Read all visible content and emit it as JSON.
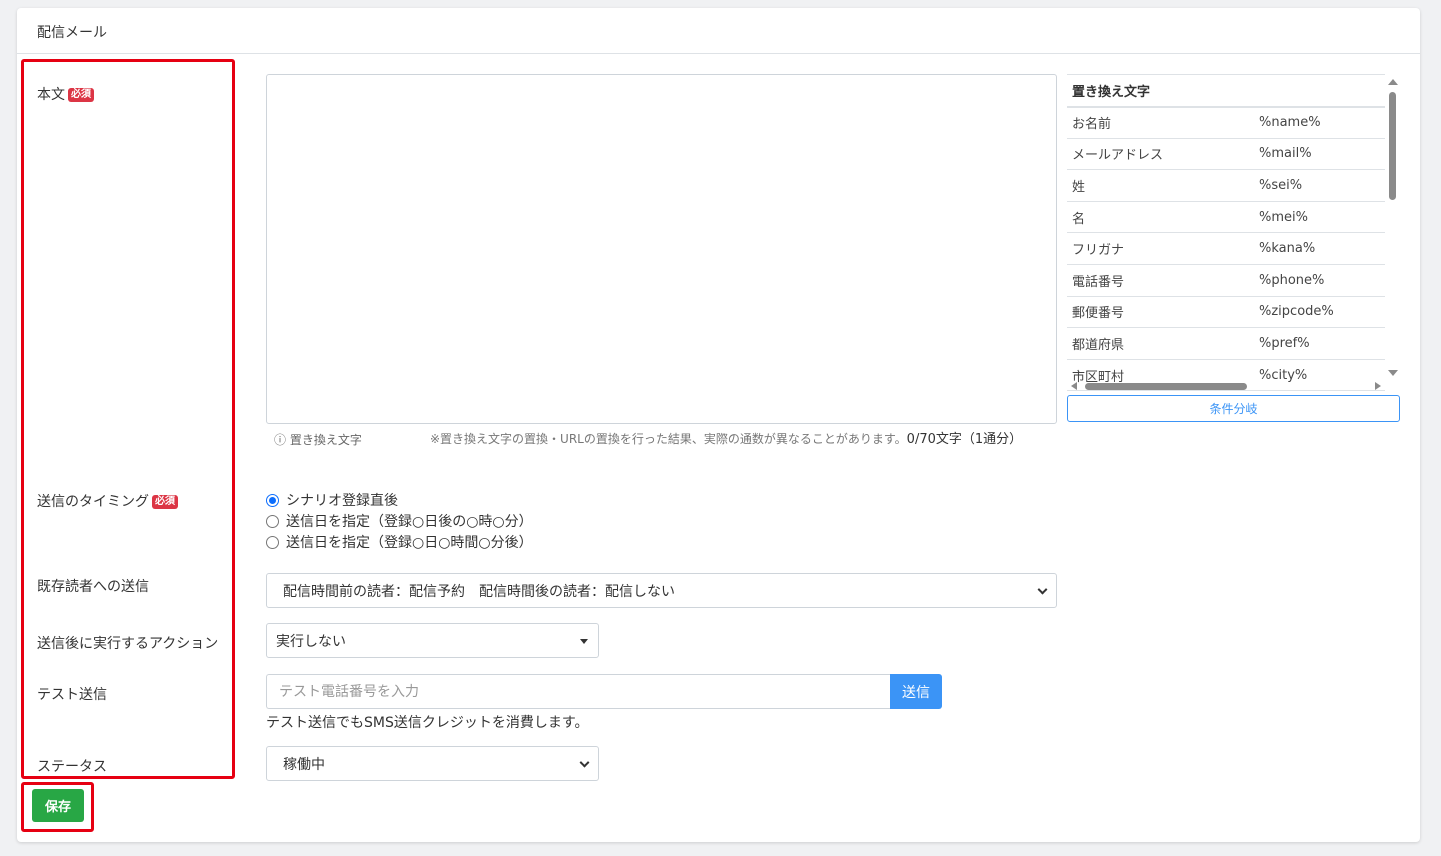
{
  "card": {
    "title": "配信メール"
  },
  "labels": {
    "body": "本文",
    "timing": "送信のタイミング",
    "existing": "既存読者への送信",
    "action": "送信後に実行するアクション",
    "test": "テスト送信",
    "status": "ステータス",
    "required": "必須"
  },
  "body_editor": {
    "value": "",
    "hint_link": "ⓘ 置き換え文字",
    "note": "※置き換え文字の置換・URLの置換を行った結果、実際の通数が異なることがあります。",
    "count": "0/70文字（1通分）"
  },
  "replacement": {
    "header": "置き換え文字",
    "rows": [
      {
        "label": "お名前",
        "code": "%name%"
      },
      {
        "label": "メールアドレス",
        "code": "%mail%"
      },
      {
        "label": "姓",
        "code": "%sei%"
      },
      {
        "label": "名",
        "code": "%mei%"
      },
      {
        "label": "フリガナ",
        "code": "%kana%"
      },
      {
        "label": "電話番号",
        "code": "%phone%"
      },
      {
        "label": "郵便番号",
        "code": "%zipcode%"
      },
      {
        "label": "都道府県",
        "code": "%pref%"
      },
      {
        "label": "市区町村",
        "code": "%city%"
      }
    ],
    "branch_button": "条件分岐"
  },
  "timing_options": [
    {
      "label": "シナリオ登録直後",
      "checked": true
    },
    {
      "label": "送信日を指定（登録○日後の○時○分）",
      "checked": false
    },
    {
      "label": "送信日を指定（登録○日○時間○分後）",
      "checked": false
    }
  ],
  "existing_select": {
    "value": "配信時間前の読者：配信予約　配信時間後の読者：配信しない"
  },
  "action_select": {
    "value": "実行しない"
  },
  "test_send": {
    "placeholder": "テスト電話番号を入力",
    "button": "送信",
    "note": "テスト送信でもSMS送信クレジットを消費します。"
  },
  "status_select": {
    "value": "稼働中"
  },
  "save_button": "保存",
  "colors": {
    "primary": "#3b94f6",
    "success": "#28a745",
    "danger": "#dc3545",
    "highlight": "#e60012"
  }
}
